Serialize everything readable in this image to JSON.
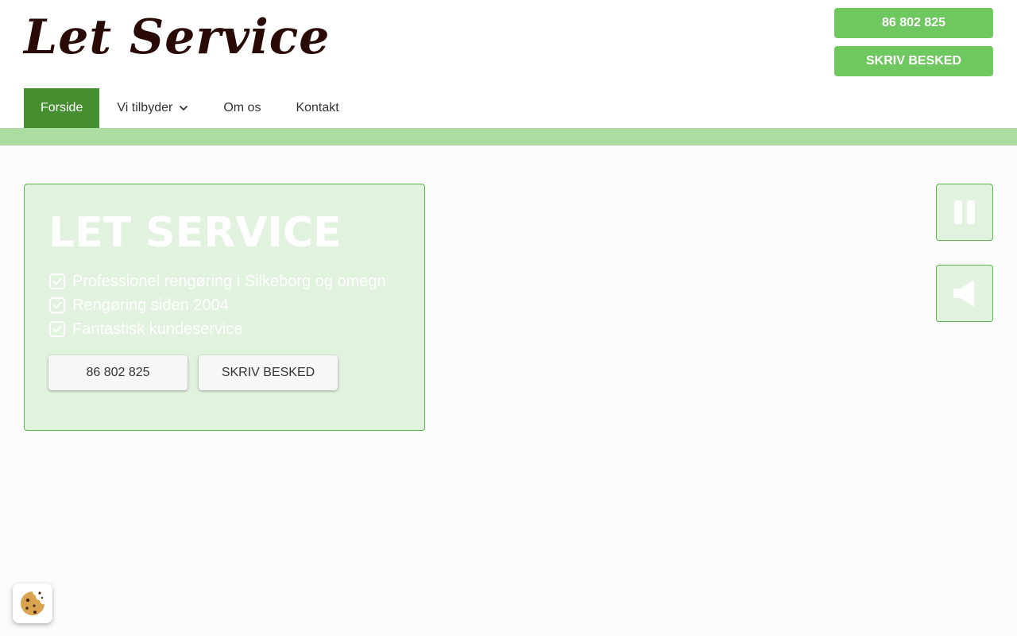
{
  "header": {
    "logo_text": "Let Service",
    "phone_button": "86 802 825",
    "message_button": "SKRIV BESKED"
  },
  "nav": {
    "items": [
      {
        "label": "Forside",
        "active": true
      },
      {
        "label": "Vi tilbyder",
        "has_dropdown": true
      },
      {
        "label": "Om os"
      },
      {
        "label": "Kontakt"
      }
    ]
  },
  "hero": {
    "title": "LET SERVICE",
    "features": [
      "Professionel rengøring i Silkeborg og omegn",
      "Rengøring siden 2004",
      "Fantastisk kundeservice"
    ],
    "phone_button": "86 802 825",
    "message_button": "SKRIV BESKED"
  },
  "controls": {
    "pause_icon": "pause-icon",
    "sound_icon": "speaker-icon"
  },
  "cookie": {
    "icon": "cookie-icon"
  },
  "colors": {
    "brand_green": "#6fc75f",
    "nav_active": "#458f31",
    "band": "#acdda0",
    "card_bg": "#e1f3de",
    "logo": "#2a0a05"
  }
}
